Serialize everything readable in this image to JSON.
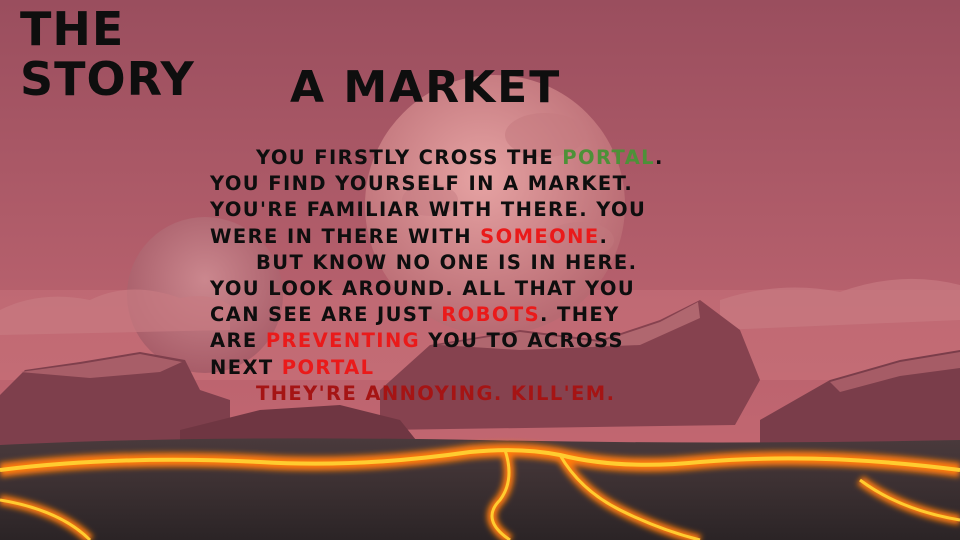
{
  "colors": {
    "sky_top": "#9a4e5e",
    "sky_bottom": "#c86a72",
    "moon": "#d88a8a",
    "rock": "#8a4a56",
    "lava": "#ffb020",
    "ground": "#3a3034",
    "text": "#0e0e0e",
    "highlight_green": "#4d9138",
    "highlight_red": "#ea1a1a",
    "highlight_dark_red": "#a51414"
  },
  "header": {
    "title_line1": "THE",
    "title_line2": "STORY"
  },
  "chapter": {
    "title": "A MARKET"
  },
  "story": {
    "line1_a": "YOU FIRSTLY CROSS THE ",
    "line1_b": "PORTAL",
    "line1_c": ".",
    "line2": "YOU FIND YOURSELF IN A MARKET.",
    "line3": "YOU'RE FAMILIAR WITH THERE. YOU",
    "line4_a": "WERE IN THERE WITH ",
    "line4_b": "SOMEONE",
    "line4_c": ".",
    "line5": "BUT KNOW NO ONE IS IN HERE.",
    "line6": "YOU LOOK AROUND. ALL THAT YOU",
    "line7_a": "CAN SEE ARE JUST ",
    "line7_b": "ROBOTS",
    "line7_c": ". THEY",
    "line8_a": "ARE ",
    "line8_b": "PREVENTING",
    "line8_c": " YOU TO ACROSS",
    "line9_a": "NEXT ",
    "line9_b": "PORTAL",
    "line10": "THEY'RE ANNOYING. KILL'EM."
  }
}
